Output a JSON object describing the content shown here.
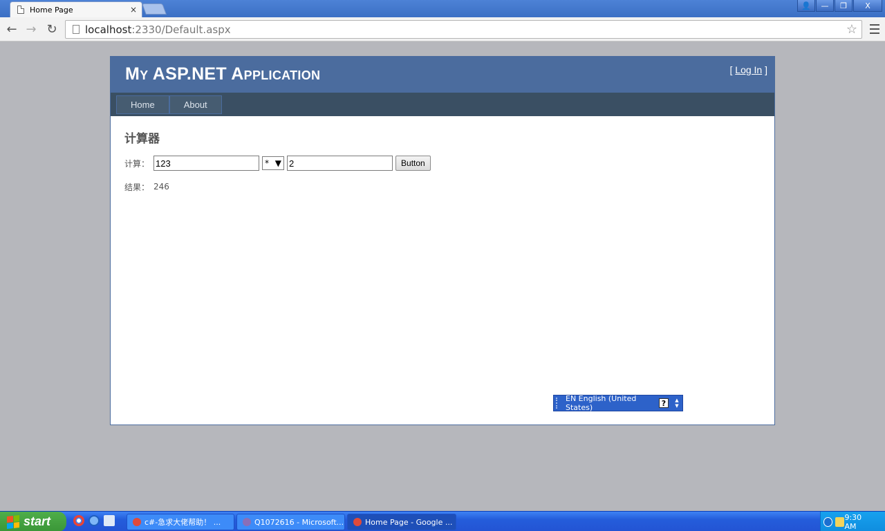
{
  "browser": {
    "tab_title": "Home Page",
    "tab_close": "×",
    "url_host": "localhost",
    "url_rest": ":2330/Default.aspx",
    "window_buttons": [
      "👤",
      "—",
      "❐",
      "X"
    ]
  },
  "site": {
    "title": "My ASP.NET Application",
    "login_prefix": "[ ",
    "login_link": "Log In",
    "login_suffix": " ]",
    "menu": [
      "Home",
      "About"
    ]
  },
  "calculator": {
    "heading": "计算器",
    "calc_label": "计算：",
    "operand1": "123",
    "operator": "*",
    "operand2": "2",
    "button_label": "Button",
    "result_label": "结果：",
    "result_value": "246"
  },
  "langbar": {
    "text": "EN English (United States)",
    "help": "?"
  },
  "taskbar": {
    "start_label": "start",
    "buttons": [
      "c#-急求大佬帮助！ ...",
      "Q1072616 - Microsoft...",
      "Home Page - Google ..."
    ],
    "clock": "9:30 AM"
  },
  "colors": {
    "header": "#4b6c9e",
    "menubar": "#3a4f63",
    "taskbar": "#245ddb",
    "start": "#3a9637"
  }
}
